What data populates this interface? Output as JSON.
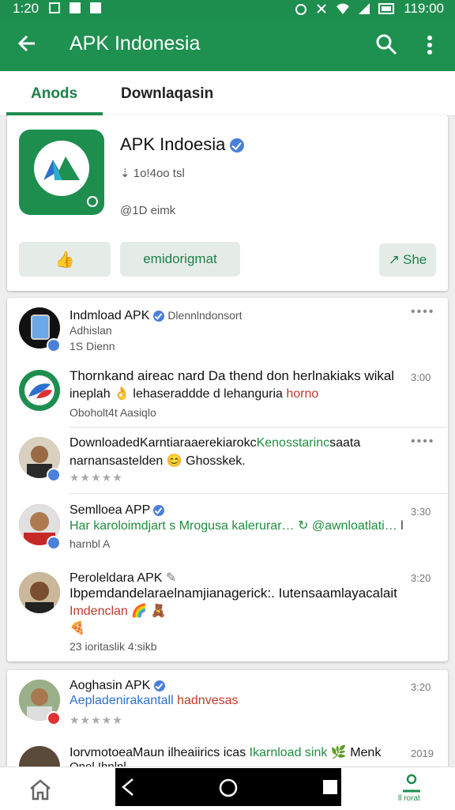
{
  "status": {
    "time_left": "1:20",
    "time_right": "119:00"
  },
  "appbar": {
    "title": "APK Indonesia"
  },
  "tabs": [
    {
      "label": "Anods"
    },
    {
      "label": "Downlaqasin"
    }
  ],
  "app": {
    "name": "APK Indoesia",
    "downloads": "1o!4oo tsl",
    "size": "@1D eimk",
    "buttons": {
      "like_label": "",
      "install_label": "emidorigmat",
      "share_label": "She"
    }
  },
  "feed": [
    {
      "name": "Indmload APK",
      "tag": "Dlennlndonsort",
      "sub1": "Adhislan",
      "sub2": "1S Dienn"
    },
    {
      "line1": "Thornkand aireac nard Da thend don herlnakiaks wikal",
      "line2_a": "ineplah 👌 lehaseraddde d lehanguria",
      "line2_b": "horno",
      "sub": "Oboholt4t  Aasiqlo",
      "time": "3:00"
    },
    {
      "line1_a": "DownloadedKarntiaraaerekiarokc",
      "line1_b": "Kenosstarinc",
      "line1_c": "saata",
      "line2": "narnansastelden 😊 Ghosskek.",
      "stars": "★★★★★"
    },
    {
      "name": "Semlloea APP",
      "line1": "Har karoloimdjart s Mrogusa kalerurar…",
      "line1_b": "@awnloatlati…",
      "line1_c": "l",
      "sub": "harnbl A",
      "time": "3:30"
    },
    {
      "name": "Peroleldara APK",
      "line1": "Ibpemdandelaraelnamjianagerick:. Iutensaamlayacalait",
      "line2": "Imdenclan",
      "sub": "23 ioritaslik   4:sikb",
      "time": "3:20"
    },
    {
      "name": "Aoghasin APK",
      "line1_a": "Aepladenirakantall",
      "line1_b": "hadnvesas",
      "stars": "★★★★★",
      "time": "3:20"
    },
    {
      "line1_a": "IorvmotoeaMaun ilheaiirics icas",
      "line1_b": "Ikarnload sink",
      "line1_c": "Menk",
      "line2": "Onol Ihnlnl...",
      "time": "2019"
    }
  ],
  "bottom": {
    "right_label": "ll rorat"
  },
  "colors": {
    "primary": "#1e8e4f",
    "accent_blue": "#4a80d8"
  }
}
